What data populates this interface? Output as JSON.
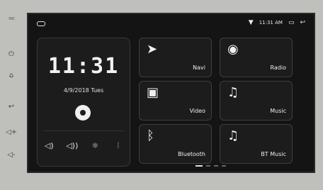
{
  "status": {
    "time": "11:31 AM",
    "wifi_icon": "wifi-icon",
    "window_icon": "window-icon",
    "back_icon": "back-icon"
  },
  "side_buttons": [
    {
      "name": "mic-label",
      "label": "MIC"
    },
    {
      "name": "power-icon"
    },
    {
      "name": "home-icon"
    },
    {
      "name": "back-icon"
    },
    {
      "name": "volume-up-icon"
    },
    {
      "name": "volume-down-icon"
    }
  ],
  "clock": {
    "time": "11:31",
    "date": "4/9/2018  Tues"
  },
  "quick": [
    "volume-down-icon",
    "volume-up-icon",
    "brightness-icon",
    "equalizer-icon"
  ],
  "tiles": {
    "navi": "Navi",
    "radio": "Radio",
    "video": "Video",
    "music": "Music",
    "bluetooth": "Bluetooth",
    "bt_music": "BT Music"
  }
}
